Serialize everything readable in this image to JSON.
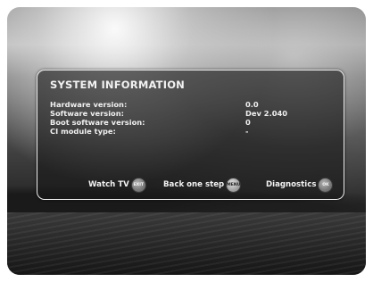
{
  "panel": {
    "title": "SYSTEM INFORMATION",
    "rows": [
      {
        "label": "Hardware version:",
        "value": "0.0"
      },
      {
        "label": "Software version:",
        "value": "Dev 2.040"
      },
      {
        "label": "Boot software version:",
        "value": "0"
      },
      {
        "label": "CI module type:",
        "value": "-"
      }
    ]
  },
  "actions": [
    {
      "label": "Watch TV",
      "key": "EXIT",
      "icon": "exit-key-icon"
    },
    {
      "label": "Back one step",
      "key": "MENU",
      "icon": "menu-key-icon"
    },
    {
      "label": "Diagnostics",
      "key": "OK",
      "icon": "ok-key-icon"
    }
  ]
}
